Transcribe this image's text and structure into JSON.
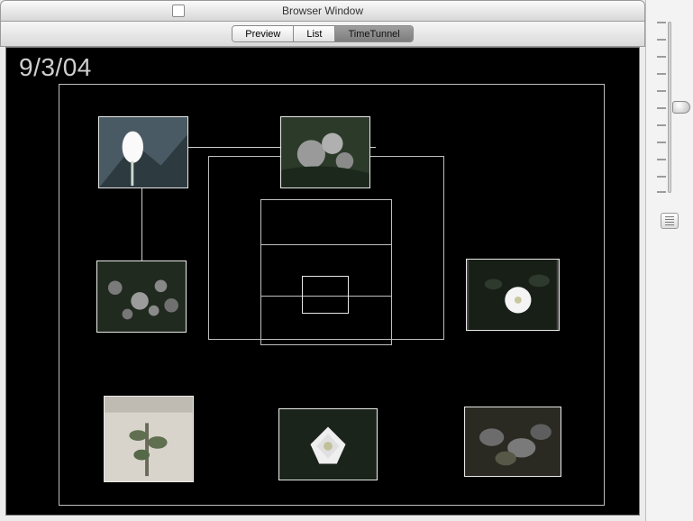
{
  "window": {
    "title": "Browser Window"
  },
  "tabs": {
    "preview": "Preview",
    "list": "List",
    "timetunnel": "TimeTunnel",
    "active": "timetunnel"
  },
  "date_label": "9/3/04",
  "slider": {
    "value_index": 4,
    "tick_count": 11
  },
  "thumbnails": [
    {
      "name": "photo-white-flower-1"
    },
    {
      "name": "photo-pink-flowers"
    },
    {
      "name": "photo-garden-cluster"
    },
    {
      "name": "photo-white-flower-dark"
    },
    {
      "name": "photo-plant-wall"
    },
    {
      "name": "photo-lily"
    },
    {
      "name": "photo-red-flowers-leaves"
    }
  ]
}
